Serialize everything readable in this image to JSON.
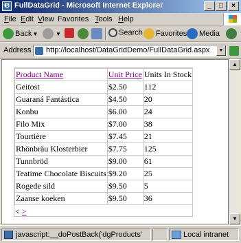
{
  "window": {
    "title": "FullDataGrid - Microsoft Internet Explorer",
    "minimize_glyph": "_",
    "maximize_glyph": "□",
    "close_glyph": "×"
  },
  "menu": {
    "items": [
      {
        "key": "F",
        "rest": "ile"
      },
      {
        "key": "E",
        "rest": "dit"
      },
      {
        "key": "V",
        "rest": "iew"
      },
      {
        "key": "",
        "rest": "Favorites"
      },
      {
        "key": "T",
        "rest": "ools"
      },
      {
        "key": "H",
        "rest": "elp"
      }
    ]
  },
  "toolbar": {
    "back_label": "Back",
    "search_label": "Search",
    "favorites_label": "Favorites",
    "media_label": "Media"
  },
  "address": {
    "label": "Address",
    "url": "http://localhost/DataGridDemo/FullDataGrid.aspx"
  },
  "grid": {
    "headers": {
      "product_name": "Product Name",
      "unit_price": "Unit Price",
      "units_in_stock": "Units In Stock"
    },
    "rows": [
      {
        "name": "Geitost",
        "price": "$2.50",
        "stock": "112"
      },
      {
        "name": "Guaraná Fantástica",
        "price": "$4.50",
        "stock": "20"
      },
      {
        "name": "Konbu",
        "price": "$6.00",
        "stock": "24"
      },
      {
        "name": "Filo Mix",
        "price": "$7.00",
        "stock": "38"
      },
      {
        "name": "Tourtière",
        "price": "$7.45",
        "stock": "21"
      },
      {
        "name": "Rhönbräu Klosterbier",
        "price": "$7.75",
        "stock": "125"
      },
      {
        "name": "Tunnbröd",
        "price": "$9.00",
        "stock": "61"
      },
      {
        "name": "Teatime Chocolate Biscuits",
        "price": "$9.20",
        "stock": "25"
      },
      {
        "name": "Rogede sild",
        "price": "$9.50",
        "stock": "5"
      },
      {
        "name": "Zaanse koeken",
        "price": "$9.50",
        "stock": "36"
      }
    ],
    "pager": {
      "prev": "<",
      "next": ">"
    }
  },
  "status": {
    "text": "javascript:__doPostBack('dgProducts'",
    "zone": "Local intranet"
  }
}
